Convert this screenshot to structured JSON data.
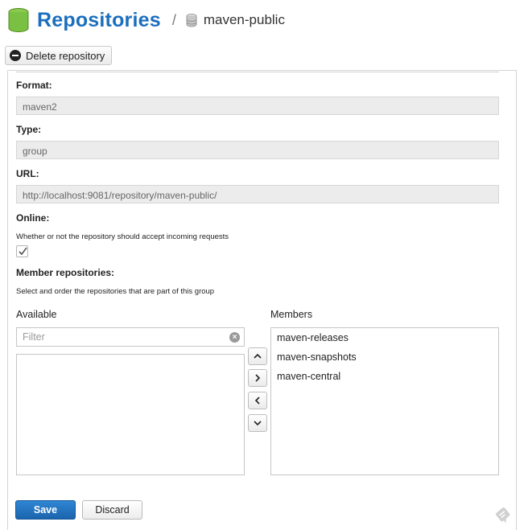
{
  "header": {
    "title": "Repositories",
    "separator": "/",
    "repository_name": "maven-public"
  },
  "toolbar": {
    "delete_label": "Delete repository"
  },
  "form": {
    "format_label": "Format:",
    "format_value": "maven2",
    "type_label": "Type:",
    "type_value": "group",
    "url_label": "URL:",
    "url_value": "http://localhost:9081/repository/maven-public/",
    "online_label": "Online:",
    "online_help": "Whether or not the repository should accept incoming requests",
    "online_checked": true,
    "members_label": "Member repositories:",
    "members_help": "Select and order the repositories that are part of this group"
  },
  "lists": {
    "available_title": "Available",
    "filter_placeholder": "Filter",
    "members_title": "Members",
    "members": [
      "maven-releases",
      "maven-snapshots",
      "maven-central"
    ]
  },
  "icons": {
    "header": "database-icon",
    "breadcrumb": "database-icon",
    "delete": "minus-circle-icon",
    "clear": "clear-icon",
    "move_up": "chevron-up-icon",
    "move_right": "chevron-right-icon",
    "move_left": "chevron-left-icon",
    "move_down": "chevron-down-icon",
    "feedback": "feedback-icon"
  },
  "actions": {
    "save_label": "Save",
    "discard_label": "Discard"
  },
  "colors": {
    "title_blue": "#1b6fbe",
    "save_blue": "#1f6cb5",
    "db_green": "#7ac143"
  }
}
